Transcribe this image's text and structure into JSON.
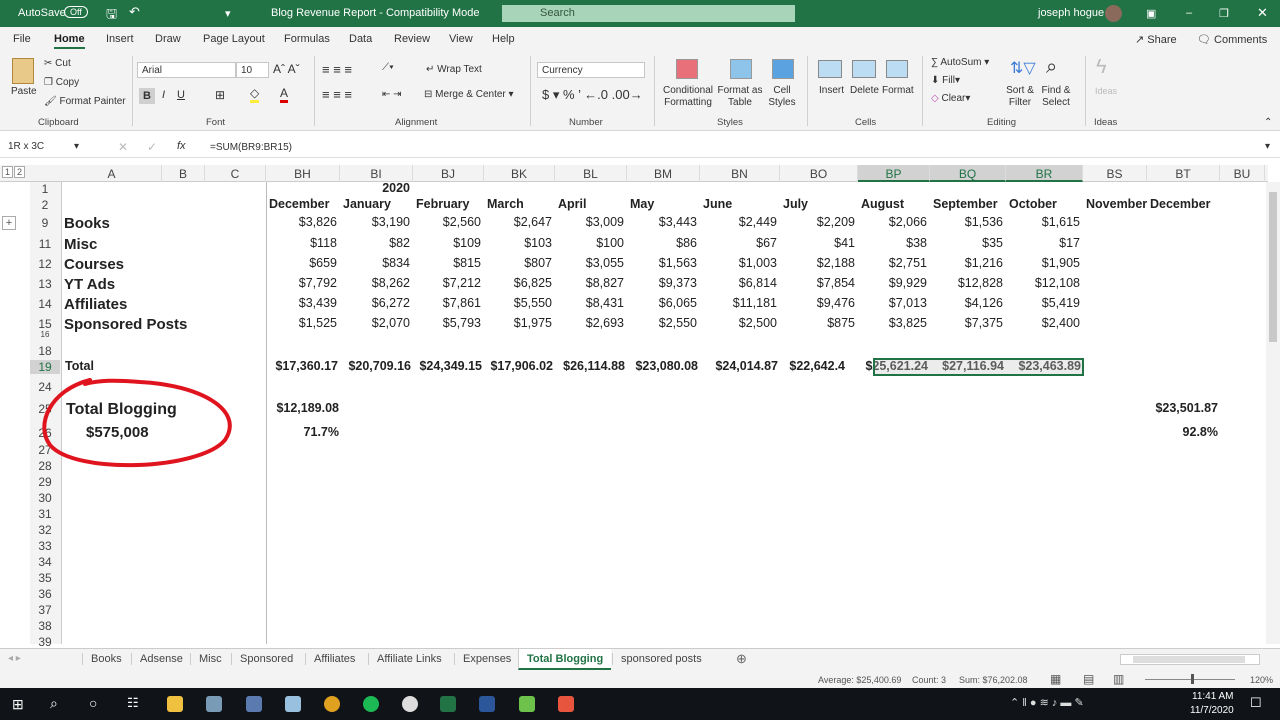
{
  "titlebar": {
    "autosave": "AutoSave",
    "autosave_state": "Off",
    "title": "Blog Revenue Report  -  Compatibility Mode",
    "search": "Search",
    "user": "joseph hogue"
  },
  "menu": [
    "File",
    "Home",
    "Insert",
    "Draw",
    "Page Layout",
    "Formulas",
    "Data",
    "Review",
    "View",
    "Help"
  ],
  "actions": {
    "share": "Share",
    "comments": "Comments"
  },
  "ribbon": {
    "clipboard": {
      "paste": "Paste",
      "cut": "Cut",
      "copy": "Copy",
      "format_painter": "Format Painter",
      "label": "Clipboard"
    },
    "font": {
      "name": "Arial",
      "size": "10",
      "label": "Font"
    },
    "alignment": {
      "wrap": "Wrap Text",
      "merge": "Merge & Center",
      "label": "Alignment"
    },
    "number": {
      "format": "Currency",
      "label": "Number"
    },
    "styles": {
      "conditional": "Conditional Formatting",
      "format_table": "Format as Table",
      "cell_styles": "Cell Styles",
      "label": "Styles"
    },
    "cells": {
      "insert": "Insert",
      "delete": "Delete",
      "format": "Format",
      "label": "Cells"
    },
    "editing": {
      "autosum": "AutoSum",
      "fill": "Fill",
      "clear": "Clear",
      "sort": "Sort & Filter",
      "find": "Find & Select",
      "label": "Editing"
    },
    "ideas": {
      "button": "Ideas",
      "label": "Ideas"
    }
  },
  "formula_bar": {
    "name_box": "1R x 3C",
    "formula": "=SUM(BR9:BR15)"
  },
  "columns": [
    "A",
    "B",
    "C",
    "BH",
    "BI",
    "BJ",
    "BK",
    "BL",
    "BM",
    "BN",
    "BO",
    "BP",
    "BQ",
    "BR",
    "BS",
    "BT",
    "BU"
  ],
  "rows": [
    "1",
    "2",
    "9",
    "11",
    "12",
    "13",
    "14",
    "15",
    "16",
    "18",
    "19",
    "24",
    "25",
    "26",
    "27",
    "28",
    "29",
    "30",
    "31",
    "32",
    "33",
    "34",
    "35",
    "36",
    "37",
    "38",
    "39"
  ],
  "outline_levels": [
    "1",
    "2"
  ],
  "sheet": {
    "year": "2020",
    "months": [
      "December",
      "January",
      "February",
      "March",
      "April",
      "May",
      "June",
      "July",
      "August",
      "September",
      "October",
      "November",
      "December"
    ],
    "categories": [
      {
        "label": "Books",
        "values": [
          "$3,826",
          "$3,190",
          "$2,560",
          "$2,647",
          "$3,009",
          "$3,443",
          "$2,449",
          "$2,209",
          "$2,066",
          "$1,536",
          "$1,615"
        ]
      },
      {
        "label": "Misc",
        "values": [
          "$118",
          "$82",
          "$109",
          "$103",
          "$100",
          "$86",
          "$67",
          "$41",
          "$38",
          "$35",
          "$17"
        ]
      },
      {
        "label": "Courses",
        "values": [
          "$659",
          "$834",
          "$815",
          "$807",
          "$3,055",
          "$1,563",
          "$1,003",
          "$2,188",
          "$2,751",
          "$1,216",
          "$1,905"
        ]
      },
      {
        "label": "YT Ads",
        "values": [
          "$7,792",
          "$8,262",
          "$7,212",
          "$6,825",
          "$8,827",
          "$9,373",
          "$6,814",
          "$7,854",
          "$9,929",
          "$12,828",
          "$12,108"
        ]
      },
      {
        "label": "Affiliates",
        "values": [
          "$3,439",
          "$6,272",
          "$7,861",
          "$5,550",
          "$8,431",
          "$6,065",
          "$11,181",
          "$9,476",
          "$7,013",
          "$4,126",
          "$5,419"
        ]
      },
      {
        "label": "Sponsored Posts",
        "values": [
          "$1,525",
          "$2,070",
          "$5,793",
          "$1,975",
          "$2,693",
          "$2,550",
          "$2,500",
          "$875",
          "$3,825",
          "$7,375",
          "$2,400"
        ]
      }
    ],
    "total": {
      "label": "Total",
      "values": [
        "$17,360.17",
        "$20,709.16",
        "$24,349.15",
        "$17,906.02",
        "$26,114.88",
        "$23,080.08",
        "$24,014.87",
        "$22,642.4",
        "$25,621.24",
        "$27,116.94",
        "$23,463.89"
      ]
    },
    "total_blogging": {
      "label": "Total Blogging",
      "amount": "$575,008",
      "bh": "$12,189.08",
      "bt": "$23,501.87",
      "bh_pct": "71.7%",
      "bt_pct": "92.8%"
    },
    "annotation_color": "#e0141e"
  },
  "sheet_tabs": [
    "Books",
    "Adsense",
    "Misc",
    "Sponsored",
    "Affiliates",
    "Affiliate Links",
    "Expenses",
    "Total Blogging",
    "sponsored posts"
  ],
  "active_tab": "Total Blogging",
  "status": {
    "average": "Average: $25,400.69",
    "count": "Count: 3",
    "sum": "Sum: $76,202.08",
    "zoom": "120%"
  },
  "taskbar": {
    "time": "11:41 AM",
    "date": "11/7/2020"
  },
  "colors": {
    "excel_green": "#217346"
  }
}
